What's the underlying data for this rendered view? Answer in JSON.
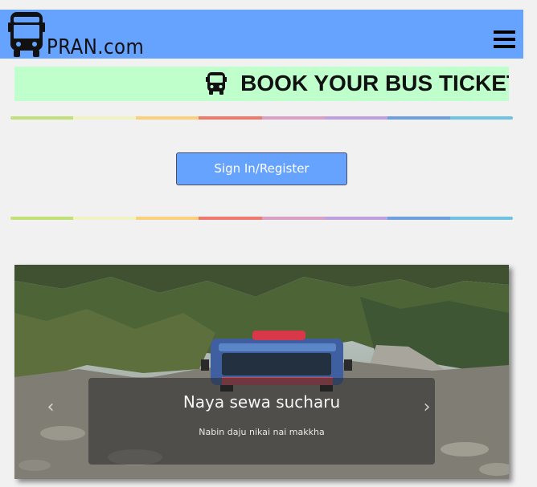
{
  "header": {
    "logo_text": "PRAN.com",
    "logo_icon": "bus-icon",
    "menu_icon": "hamburger-menu-icon",
    "background_color": "#66a3ff"
  },
  "banner": {
    "icon": "bus-icon",
    "text": "BOOK YOUR BUS TICKET",
    "background_color": "#bfffcc"
  },
  "divider_colors": [
    "#c1e07a",
    "#f1f2c4",
    "#fbd07c",
    "#ee7a6b",
    "#da9fc4",
    "#bf9fdc",
    "#6f9fe0",
    "#6fc2e2"
  ],
  "auth": {
    "signin_label": "Sign In/Register",
    "button_color": "#66a3ff"
  },
  "carousel": {
    "slide_title": "Naya sewa sucharu",
    "slide_caption": "Nabin daju nikai nai makkha",
    "prev_icon": "chevron-left-icon",
    "next_icon": "chevron-right-icon",
    "prev_glyph": "‹",
    "next_glyph": "›"
  }
}
